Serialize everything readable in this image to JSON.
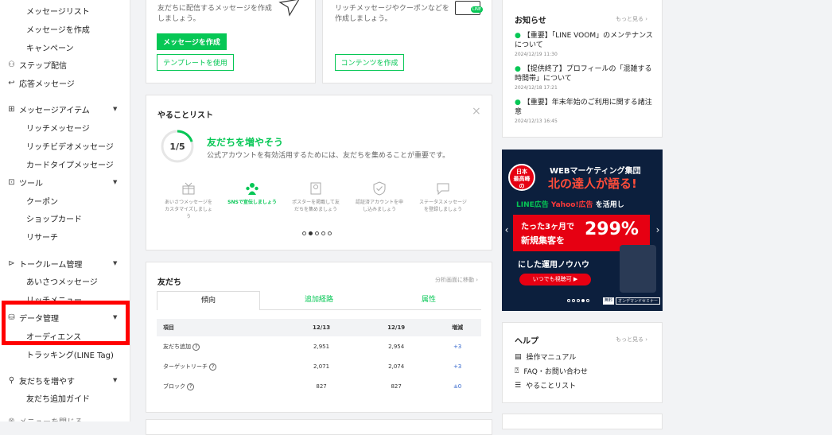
{
  "sidebar": {
    "items": [
      {
        "label": "メッセージリスト",
        "type": "sub"
      },
      {
        "label": "メッセージを作成",
        "type": "sub"
      },
      {
        "label": "キャンペーン",
        "type": "sub"
      },
      {
        "label": "ステップ配信",
        "type": "head",
        "icon": "step-icon"
      },
      {
        "label": "応答メッセージ",
        "type": "head",
        "icon": "reply-icon"
      },
      {
        "label": "メッセージアイテム",
        "type": "head",
        "icon": "message-item-icon"
      },
      {
        "label": "リッチメッセージ",
        "type": "sub"
      },
      {
        "label": "リッチビデオメッセージ",
        "type": "sub"
      },
      {
        "label": "カードタイプメッセージ",
        "type": "sub"
      },
      {
        "label": "ツール",
        "type": "head",
        "icon": "tool-icon"
      },
      {
        "label": "クーポン",
        "type": "sub"
      },
      {
        "label": "ショップカード",
        "type": "sub"
      },
      {
        "label": "リサーチ",
        "type": "sub"
      },
      {
        "label": "トークルーム管理",
        "type": "head",
        "icon": "talkroom-icon"
      },
      {
        "label": "あいさつメッセージ",
        "type": "sub"
      },
      {
        "label": "リッチメニュー",
        "type": "sub"
      },
      {
        "label": "データ管理",
        "type": "head",
        "icon": "database-icon"
      },
      {
        "label": "オーディエンス",
        "type": "sub"
      },
      {
        "label": "トラッキング(LINE Tag)",
        "type": "sub"
      },
      {
        "label": "友だちを増やす",
        "type": "head",
        "icon": "add-friend-icon"
      },
      {
        "label": "友だち追加ガイド",
        "type": "sub"
      },
      {
        "label": "メニューを閉じる",
        "type": "head",
        "icon": "close-menu-icon"
      }
    ]
  },
  "message_card": {
    "desc_line1": "友だちに配信するメッセージを作成",
    "desc_line2": "しましょう。",
    "create_button": "メッセージを作成",
    "template_button": "テンプレートを使用"
  },
  "content_card": {
    "desc_line1": "リッチメッセージやクーポンなどを",
    "desc_line2": "作成しましょう。",
    "create_button": "コンテンツを作成",
    "icon_badge": "LINE"
  },
  "todo": {
    "title": "やることリスト",
    "progress": "1/5",
    "progress_fraction": 0.2,
    "heading": "友だちを増やそう",
    "desc": "公式アカウントを有効活用するためには、友だちを集めることが重要です。",
    "steps": [
      {
        "text": "あいさつメッセージをカスタマイズしましょう",
        "active": false
      },
      {
        "text": "SNSで宣伝しましょう",
        "active": true
      },
      {
        "text": "ポスターを掲載して友だちを集めましょう",
        "active": false
      },
      {
        "text": "認証済アカウントを申し込みましょう",
        "active": false
      },
      {
        "text": "ステータスメッセージを登録しましょう",
        "active": false
      }
    ]
  },
  "friends": {
    "title": "友だち",
    "analysis_link": "分析画面に移動",
    "tabs": [
      "傾向",
      "追加経路",
      "属性"
    ],
    "headers": [
      "項目",
      "12/13",
      "12/19",
      "増減"
    ],
    "rows": [
      {
        "label": "友だち追加",
        "a": "2,951",
        "b": "2,954",
        "delta": "+3"
      },
      {
        "label": "ターゲットリーチ",
        "a": "2,071",
        "b": "2,074",
        "delta": "+3"
      },
      {
        "label": "ブロック",
        "a": "827",
        "b": "827",
        "delta": "±0"
      }
    ]
  },
  "news": {
    "title": "お知らせ",
    "more": "もっと見る",
    "items": [
      {
        "line1": "【重要】「LINE VOOM」のメンテナンス",
        "line2": "について",
        "date": "2024/12/19 11:30"
      },
      {
        "line1": "【提供終了】プロフィールの「混雑する",
        "line2": "時間帯」について",
        "date": "2024/12/18 17:21"
      },
      {
        "line1": "【重要】年末年始のご利用に関する諸注",
        "line2": "意",
        "date": "2024/12/13 16:45"
      }
    ]
  },
  "banner": {
    "badge_l1": "日本",
    "badge_l2": "最高峰",
    "badge_l3": "の",
    "line1": "WEBマーケティング集団",
    "line2": "北の達人が語る!",
    "line3a": "LINE広告",
    "line3b": "Yahoo!広告",
    "line3c": "を活用し",
    "box_l1": "たった3ヶ月で",
    "box_l2": "新規集客を",
    "percent": "299%",
    "line5": "にした運用ノウハウ",
    "cta": "いつでも視聴可",
    "tag1": "無料",
    "tag2": "オンデマンドセミナー"
  },
  "help": {
    "title": "ヘルプ",
    "more": "もっと見る",
    "items": [
      {
        "label": "操作マニュアル",
        "icon": "manual-icon"
      },
      {
        "label": "FAQ・お問い合わせ",
        "icon": "faq-icon"
      },
      {
        "label": "やることリスト",
        "icon": "todo-list-icon"
      }
    ]
  },
  "colors": {
    "accent": "#06c755",
    "highlight": "#ff0000",
    "delta": "#3366cc"
  }
}
